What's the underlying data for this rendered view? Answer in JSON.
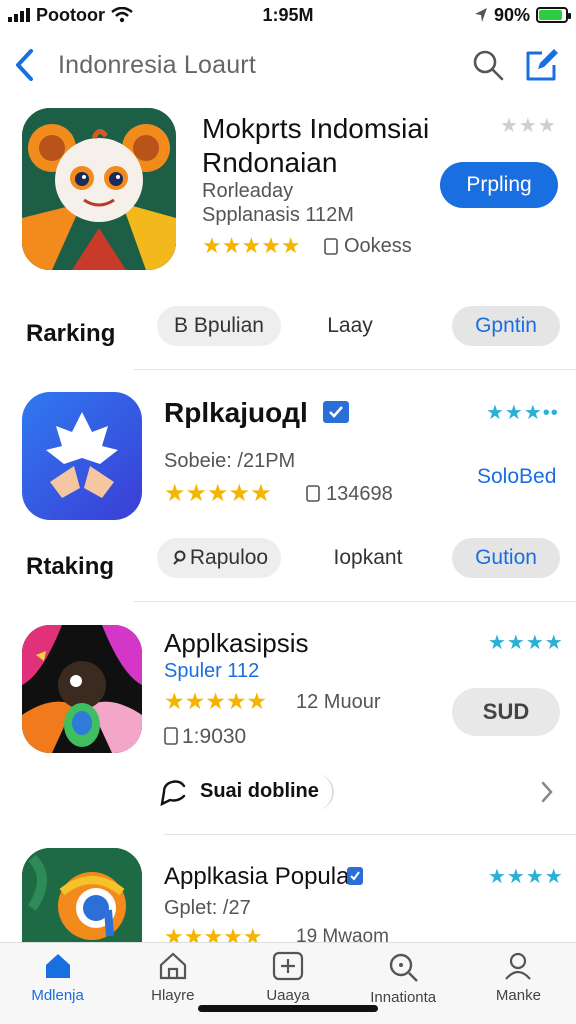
{
  "status_bar": {
    "carrier": "Pootoor",
    "time": "1:95M",
    "battery": "90%",
    "battery_level": 0.9
  },
  "header": {
    "title": "Indonresia  Loaurt"
  },
  "featured": {
    "name_line1": "Mokprts Indomsiai",
    "name_line2": "Rndonaian",
    "meta_line1": "Rorleaday",
    "meta_line2": "Spplanasis 112M",
    "stars": "★★★★★",
    "reviews": "Ookess",
    "mini_rating": "★★★",
    "action_label": "Prpling"
  },
  "ranking_row_1": {
    "label": "Rarking",
    "chips": [
      "B Bpulian",
      "Laay",
      "Gpntin"
    ]
  },
  "app_2": {
    "name": "Rplkajuoдl",
    "meta": "Sobeie: /21PM",
    "stars": "★★★★★",
    "reviews": "134698",
    "mini_rating": "★★★••",
    "action_label": "SoloBed"
  },
  "ranking_row_2": {
    "label": "Rtaking",
    "chips": [
      "Rapuloo",
      "Iopkant",
      "Gution"
    ]
  },
  "app_3": {
    "name": "Applkasipsis",
    "meta": "Spuler 112",
    "stars": "★★★★★",
    "reviews": "12 Muour",
    "size": "1:9030",
    "mini_rating": "★★★★",
    "action_label": "SUD",
    "sub_link": "Suai dobline"
  },
  "app_4": {
    "name": "Applkasia Popular",
    "meta": "Gplet: /27",
    "stars": "★★★★★",
    "reviews": "19 Mwaom",
    "mini_rating": "★★★★"
  },
  "tabs": [
    {
      "label": "Mdlenja",
      "icon": "home-icon"
    },
    {
      "label": "Hlayre",
      "icon": "house-outline-icon"
    },
    {
      "label": "Uaaya",
      "icon": "add-square-icon"
    },
    {
      "label": "Innationta",
      "icon": "search-icon"
    },
    {
      "label": "Manke",
      "icon": "profile-icon"
    }
  ],
  "colors": {
    "accent": "#1a6fe0",
    "star": "#f5b400",
    "teal_star": "#2ab0d6"
  }
}
